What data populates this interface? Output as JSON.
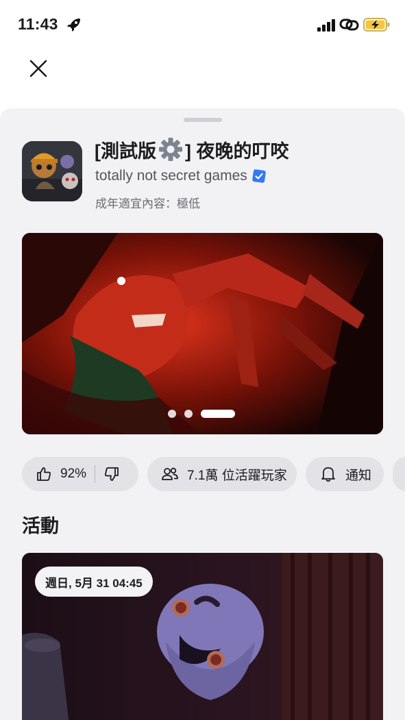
{
  "status_bar": {
    "time": "11:43",
    "icons": [
      "rocket-icon",
      "cellular-signal-icon",
      "personal-hotspot-icon",
      "battery-charging-icon"
    ],
    "battery_color": "#f5c542"
  },
  "top_bar": {
    "close_icon": "close-icon"
  },
  "game": {
    "title_prefix": "[測試版",
    "title_icon": "gear-icon",
    "title_suffix": "] 夜晚的叮咬",
    "developer": "totally not secret games",
    "verified_icon": "verified-badge-icon",
    "maturity": "成年適宜內容：極低"
  },
  "carousel": {
    "slides": 3,
    "active_slide": 3
  },
  "stats": {
    "approval": "92%",
    "players": "7.1萬 位活躍玩家",
    "notify_label": "通知"
  },
  "events": {
    "section_title": "活動",
    "date": "週日, 5月 31 04:45"
  },
  "colors": {
    "sheet_bg": "#f2f2f4",
    "pill_bg": "#e3e3e7",
    "verified_blue": "#3478f6",
    "text_primary": "#1c1c1e",
    "text_secondary": "#55555b"
  }
}
